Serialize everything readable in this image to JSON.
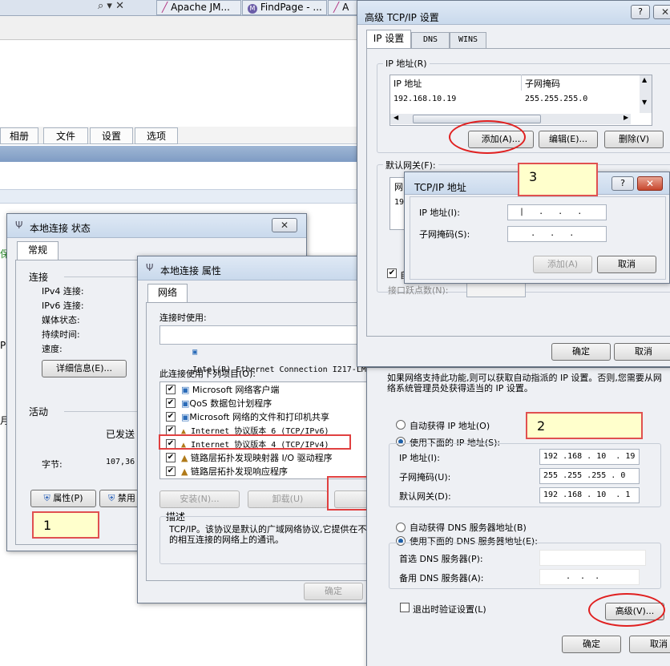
{
  "browser": {
    "search_icons": "⌕ ▾ ✕",
    "tabs": [
      "Apache JM...",
      "FindPage - ...",
      "A"
    ]
  },
  "bg_app": {
    "tabs": [
      "相册",
      "文件",
      "设置",
      "选项"
    ],
    "side_chars": [
      "保",
      "P",
      "月"
    ]
  },
  "status_window": {
    "title": "本地连接 状态",
    "tab": "常规",
    "section_connection": "连接",
    "ipv4": "IPv4 连接:",
    "ipv6": "IPv6 连接:",
    "media": "媒体状态:",
    "duration": "持续时间:",
    "speed": "速度:",
    "details_button": "详细信息(E)...",
    "section_activity": "活动",
    "sent": "已发送",
    "bytes_label": "字节:",
    "bytes_value": "107,36",
    "properties_button": "属性(P)",
    "disable_button": "禁用"
  },
  "props_window": {
    "title": "本地连接 属性",
    "tab": "网络",
    "connect_using": "连接时使用:",
    "adapter": "Intel(R) Ethernet Connection I217-LM",
    "items_label": "此连接使用下列项目(O):",
    "items": [
      "Microsoft 网络客户端",
      "QoS 数据包计划程序",
      "Microsoft 网络的文件和打印机共享",
      "Internet 协议版本 6 (TCP/IPv6)",
      "Internet 协议版本 4 (TCP/IPv4)",
      "链路层拓扑发现映射器 I/O 驱动程序",
      "链路层拓扑发现响应程序"
    ],
    "install_button": "安装(N)...",
    "uninstall_button": "卸载(U)",
    "properties_button": "属",
    "desc_label": "描述",
    "desc_text": "TCP/IP。该协议是默认的广域网络协议,它提供在不同的相互连接的网络上的通讯。",
    "ok_button": "确定"
  },
  "ipv4_window": {
    "intro": "如果网络支持此功能,则可以获取自动指派的 IP 设置。否则,您需要从网络系统管理员处获得适当的 IP 设置。",
    "auto_ip": "自动获得 IP 地址(O)",
    "manual_ip": "使用下面的 IP 地址(S):",
    "ip_label": "IP 地址(I):",
    "ip_value": "192 .168 . 10  . 19",
    "mask_label": "子网掩码(U):",
    "mask_value": "255 .255 .255 . 0",
    "gateway_label": "默认网关(D):",
    "gateway_value": "192 .168 . 10  . 1",
    "auto_dns": "自动获得 DNS 服务器地址(B)",
    "manual_dns": "使用下面的 DNS 服务器地址(E):",
    "dns1_label": "首选 DNS 服务器(P):",
    "dns2_label": "备用 DNS 服务器(A):",
    "dns2_value": ".  .  .",
    "validate": "退出时验证设置(L)",
    "advanced_button": "高级(V)...",
    "ok_button": "确定",
    "cancel_button": "取消"
  },
  "adv_window": {
    "title": "高级 TCP/IP 设置",
    "tabs": [
      "IP 设置",
      "DNS",
      "WINS"
    ],
    "ip_group": "IP 地址(R)",
    "col_ip": "IP 地址",
    "col_mask": "子网掩码",
    "row_ip": "192.168.10.19",
    "row_mask": "255.255.255.0",
    "add_button": "添加(A)...",
    "edit_button": "编辑(E)...",
    "delete_button": "删除(V)",
    "gateway_group": "默认网关(F):",
    "gw_col_stub": "网",
    "gw_row_stub": "19",
    "auto_check_stub": "自",
    "metric_label": "接口跃点数(N):",
    "ok_button": "确定",
    "cancel_button": "取消"
  },
  "tcpip_dialog": {
    "title": "TCP/IP 地址",
    "ip_label": "IP 地址(I):",
    "ip_value": "|   .   .   .",
    "mask_label": "子网掩码(S):",
    "mask_value": "    .   .   .",
    "add_button": "添加(A)",
    "cancel_button": "取消"
  },
  "annotations": [
    "1",
    "2",
    "3"
  ]
}
